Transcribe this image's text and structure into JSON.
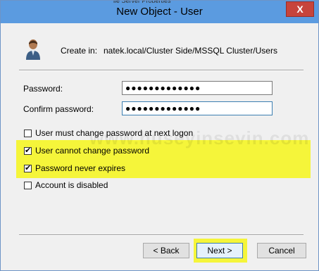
{
  "window": {
    "title": "New Object - User",
    "close_label": "X",
    "top_sliver_text": "ile Server Properties"
  },
  "header": {
    "create_in_label": "Create in:",
    "create_in_path": "natek.local/Cluster Side/MSSQL Cluster/Users"
  },
  "fields": {
    "password_label": "Password:",
    "password_value": "●●●●●●●●●●●●●",
    "confirm_label": "Confirm password:",
    "confirm_value": "●●●●●●●●●●●●●"
  },
  "options": [
    {
      "label": "User must change password at next logon",
      "checked": false
    },
    {
      "label": "User cannot change password",
      "checked": true
    },
    {
      "label": "Password never expires",
      "checked": true
    },
    {
      "label": "Account is disabled",
      "checked": false
    }
  ],
  "watermark": "www.huseyinsevin.com",
  "buttons": {
    "back": "< Back",
    "next": "Next >",
    "cancel": "Cancel"
  },
  "colors": {
    "titlebar": "#5b9be0",
    "highlight": "#f5f53a",
    "close": "#c7443b"
  }
}
